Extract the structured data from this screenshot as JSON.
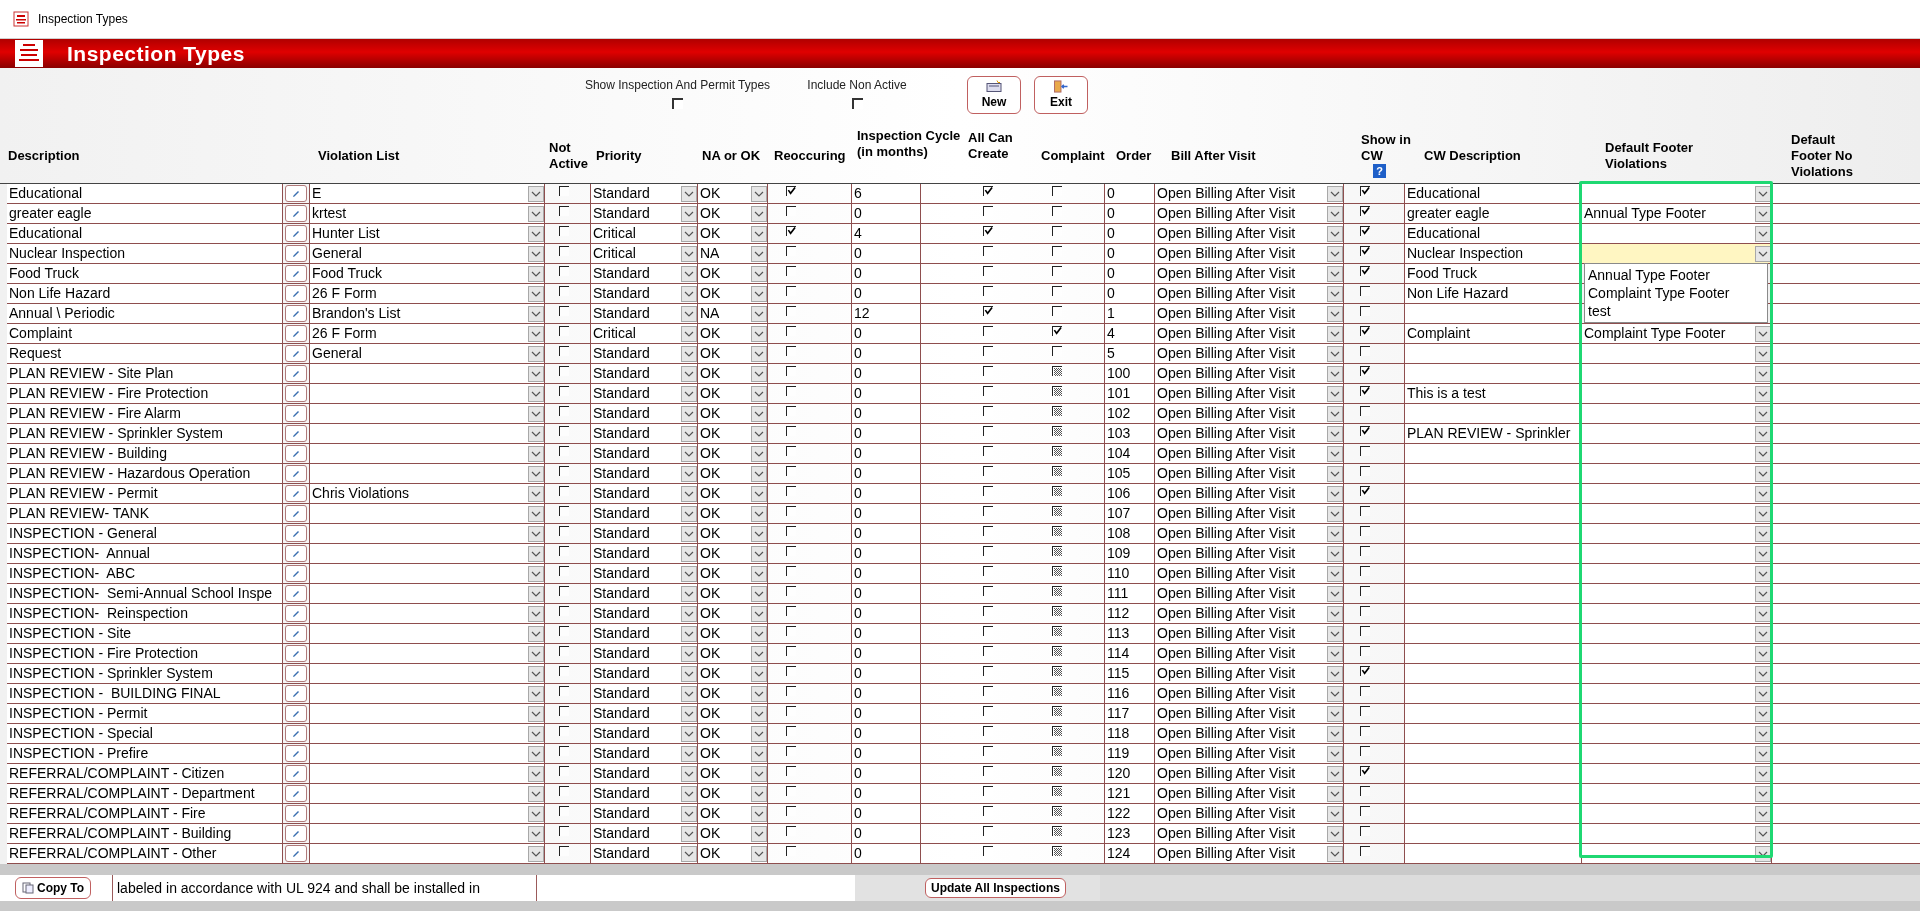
{
  "window": {
    "title": "Inspection Types"
  },
  "banner": {
    "title": "Inspection Types"
  },
  "filters": [
    {
      "label": "Show Inspection And Permit Types",
      "checked": false
    },
    {
      "label": "Include Non Active",
      "checked": false
    }
  ],
  "buttons": [
    {
      "label": "New",
      "kind": "new"
    },
    {
      "label": "Exit",
      "kind": "exit"
    }
  ],
  "table": {
    "footer_column_selected": true,
    "columns": [
      {
        "label": "Description"
      },
      {
        "label": "Violation List"
      },
      {
        "label": "Not Active"
      },
      {
        "label": "Priority"
      },
      {
        "label": "NA or OK"
      },
      {
        "label": "Reoccuring"
      },
      {
        "label": "Inspection Cycle (in months)"
      },
      {
        "label": "All Can Create"
      },
      {
        "label": "Complaint"
      },
      {
        "label": "Order"
      },
      {
        "label": "Bill After Visit"
      },
      {
        "label": "Show in CW",
        "help": "?"
      },
      {
        "label": "CW Description"
      },
      {
        "label": "Default Footer Violations"
      },
      {
        "label": "Default Footer No Violations"
      }
    ],
    "rows": [
      {
        "description": "Educational",
        "violation_list": "E",
        "not_active": false,
        "priority": "Standard",
        "na_ok": "OK",
        "reoccuring": true,
        "cycle": "6",
        "all_can_create": true,
        "complaint": false,
        "complaint_mixed": false,
        "order": "0",
        "bill": "Open Billing After Visit",
        "show_in_cw": true,
        "cw_description": "Educational",
        "footer_open": false
      },
      {
        "description": "greater eagle",
        "violation_list": "krtest",
        "not_active": false,
        "priority": "Standard",
        "na_ok": "OK",
        "reoccuring": false,
        "cycle": "0",
        "all_can_create": false,
        "complaint": false,
        "complaint_mixed": false,
        "order": "0",
        "bill": "Open Billing After Visit",
        "show_in_cw": true,
        "cw_description": "greater eagle",
        "footer": "Annual Type Footer",
        "footer_open": false
      },
      {
        "description": "Educational",
        "violation_list": "Hunter List",
        "not_active": false,
        "priority": "Critical",
        "na_ok": "OK",
        "reoccuring": true,
        "cycle": "4",
        "all_can_create": true,
        "complaint": false,
        "complaint_mixed": false,
        "order": "0",
        "bill": "Open Billing After Visit",
        "show_in_cw": true,
        "cw_description": "Educational",
        "footer_open": false
      },
      {
        "description": "Nuclear Inspection",
        "violation_list": "General",
        "not_active": false,
        "priority": "Critical",
        "na_ok": "NA",
        "reoccuring": false,
        "cycle": "0",
        "all_can_create": false,
        "complaint": false,
        "complaint_mixed": false,
        "order": "0",
        "bill": "Open Billing After Visit",
        "show_in_cw": true,
        "cw_description": "Nuclear Inspection",
        "footer_open": true,
        "footer_options": [
          "Annual Type Footer",
          "Complaint Type Footer",
          "test"
        ]
      },
      {
        "description": "Food Truck",
        "violation_list": "Food Truck",
        "not_active": false,
        "priority": "Standard",
        "na_ok": "OK",
        "reoccuring": false,
        "cycle": "0",
        "all_can_create": false,
        "complaint": false,
        "complaint_mixed": false,
        "order": "0",
        "bill": "Open Billing After Visit",
        "show_in_cw": true,
        "cw_description": "Food Truck",
        "footer_open": false
      },
      {
        "description": "Non Life Hazard",
        "violation_list": "26 F Form",
        "not_active": false,
        "priority": "Standard",
        "na_ok": "OK",
        "reoccuring": false,
        "cycle": "0",
        "all_can_create": false,
        "complaint": false,
        "complaint_mixed": false,
        "order": "0",
        "bill": "Open Billing After Visit",
        "show_in_cw": false,
        "cw_description": "Non Life Hazard",
        "footer_open": false
      },
      {
        "description": "Annual \\ Periodic",
        "violation_list": "Brandon's List",
        "not_active": false,
        "priority": "Standard",
        "na_ok": "NA",
        "reoccuring": false,
        "cycle": "12",
        "all_can_create": true,
        "complaint": false,
        "complaint_mixed": false,
        "order": "1",
        "bill": "Open Billing After Visit",
        "show_in_cw": false,
        "footer_open": false
      },
      {
        "description": "Complaint",
        "violation_list": "26 F Form",
        "not_active": false,
        "priority": "Critical",
        "na_ok": "OK",
        "reoccuring": false,
        "cycle": "0",
        "all_can_create": false,
        "complaint": true,
        "complaint_mixed": false,
        "order": "4",
        "bill": "Open Billing After Visit",
        "show_in_cw": true,
        "cw_description": "Complaint",
        "footer": "Complaint Type Footer",
        "footer_open": false
      },
      {
        "description": "Request",
        "violation_list": "General",
        "not_active": false,
        "priority": "Standard",
        "na_ok": "OK",
        "reoccuring": false,
        "cycle": "0",
        "all_can_create": false,
        "complaint": false,
        "complaint_mixed": false,
        "order": "5",
        "bill": "Open Billing After Visit",
        "show_in_cw": false,
        "footer_open": false
      },
      {
        "description": "PLAN REVIEW - Site Plan",
        "not_active": false,
        "priority": "Standard",
        "na_ok": "OK",
        "reoccuring": false,
        "cycle": "0",
        "all_can_create": false,
        "complaint_mixed": true,
        "order": "100",
        "bill": "Open Billing After Visit",
        "show_in_cw": true,
        "footer_open": false
      },
      {
        "description": "PLAN REVIEW - Fire Protection",
        "not_active": false,
        "priority": "Standard",
        "na_ok": "OK",
        "reoccuring": false,
        "cycle": "0",
        "all_can_create": false,
        "complaint_mixed": true,
        "order": "101",
        "bill": "Open Billing After Visit",
        "show_in_cw": true,
        "cw_description": "This is a test",
        "footer_open": false
      },
      {
        "description": "PLAN REVIEW - Fire Alarm",
        "not_active": false,
        "priority": "Standard",
        "na_ok": "OK",
        "reoccuring": false,
        "cycle": "0",
        "all_can_create": false,
        "complaint_mixed": true,
        "order": "102",
        "bill": "Open Billing After Visit",
        "show_in_cw": false,
        "footer_open": false
      },
      {
        "description": "PLAN REVIEW - Sprinkler System",
        "not_active": false,
        "priority": "Standard",
        "na_ok": "OK",
        "reoccuring": false,
        "cycle": "0",
        "all_can_create": false,
        "complaint_mixed": true,
        "order": "103",
        "bill": "Open Billing After Visit",
        "show_in_cw": true,
        "cw_description": "PLAN REVIEW - Sprinkler",
        "footer_open": false
      },
      {
        "description": "PLAN REVIEW - Building",
        "not_active": false,
        "priority": "Standard",
        "na_ok": "OK",
        "reoccuring": false,
        "cycle": "0",
        "all_can_create": false,
        "complaint_mixed": true,
        "order": "104",
        "bill": "Open Billing After Visit",
        "show_in_cw": false,
        "footer_open": false
      },
      {
        "description": "PLAN REVIEW - Hazardous Operation",
        "not_active": false,
        "priority": "Standard",
        "na_ok": "OK",
        "reoccuring": false,
        "cycle": "0",
        "all_can_create": false,
        "complaint_mixed": true,
        "order": "105",
        "bill": "Open Billing After Visit",
        "show_in_cw": false,
        "footer_open": false
      },
      {
        "description": "PLAN REVIEW - Permit",
        "violation_list": "Chris Violations",
        "not_active": false,
        "priority": "Standard",
        "na_ok": "OK",
        "reoccuring": false,
        "cycle": "0",
        "all_can_create": false,
        "complaint_mixed": true,
        "order": "106",
        "bill": "Open Billing After Visit",
        "show_in_cw": true,
        "footer_open": false
      },
      {
        "description": "PLAN REVIEW- TANK",
        "not_active": false,
        "priority": "Standard",
        "na_ok": "OK",
        "reoccuring": false,
        "cycle": "0",
        "all_can_create": false,
        "complaint_mixed": true,
        "order": "107",
        "bill": "Open Billing After Visit",
        "show_in_cw": false,
        "footer_open": false
      },
      {
        "description": "INSPECTION - General",
        "not_active": false,
        "priority": "Standard",
        "na_ok": "OK",
        "reoccuring": false,
        "cycle": "0",
        "all_can_create": false,
        "complaint_mixed": true,
        "order": "108",
        "bill": "Open Billing After Visit",
        "show_in_cw": false,
        "footer_open": false
      },
      {
        "description": "INSPECTION-  Annual",
        "not_active": false,
        "priority": "Standard",
        "na_ok": "OK",
        "reoccuring": false,
        "cycle": "0",
        "all_can_create": false,
        "complaint_mixed": true,
        "order": "109",
        "bill": "Open Billing After Visit",
        "show_in_cw": false,
        "footer_open": false
      },
      {
        "description": "INSPECTION-  ABC",
        "not_active": false,
        "priority": "Standard",
        "na_ok": "OK",
        "reoccuring": false,
        "cycle": "0",
        "all_can_create": false,
        "complaint_mixed": true,
        "order": "110",
        "bill": "Open Billing After Visit",
        "show_in_cw": false,
        "footer_open": false
      },
      {
        "description": "INSPECTION-  Semi-Annual School Inspe",
        "not_active": false,
        "priority": "Standard",
        "na_ok": "OK",
        "reoccuring": false,
        "cycle": "0",
        "all_can_create": false,
        "complaint_mixed": true,
        "order": "111",
        "bill": "Open Billing After Visit",
        "show_in_cw": false,
        "footer_open": false
      },
      {
        "description": "INSPECTION-  Reinspection",
        "not_active": false,
        "priority": "Standard",
        "na_ok": "OK",
        "reoccuring": false,
        "cycle": "0",
        "all_can_create": false,
        "complaint_mixed": true,
        "order": "112",
        "bill": "Open Billing After Visit",
        "show_in_cw": false,
        "footer_open": false
      },
      {
        "description": "INSPECTION - Site",
        "not_active": false,
        "priority": "Standard",
        "na_ok": "OK",
        "reoccuring": false,
        "cycle": "0",
        "all_can_create": false,
        "complaint_mixed": true,
        "order": "113",
        "bill": "Open Billing After Visit",
        "show_in_cw": false,
        "footer_open": false
      },
      {
        "description": "INSPECTION - Fire Protection",
        "not_active": false,
        "priority": "Standard",
        "na_ok": "OK",
        "reoccuring": false,
        "cycle": "0",
        "all_can_create": false,
        "complaint_mixed": true,
        "order": "114",
        "bill": "Open Billing After Visit",
        "show_in_cw": false,
        "footer_open": false
      },
      {
        "description": "INSPECTION - Sprinkler System",
        "not_active": false,
        "priority": "Standard",
        "na_ok": "OK",
        "reoccuring": false,
        "cycle": "0",
        "all_can_create": false,
        "complaint_mixed": true,
        "order": "115",
        "bill": "Open Billing After Visit",
        "show_in_cw": true,
        "footer_open": false
      },
      {
        "description": "INSPECTION -  BUILDING FINAL",
        "not_active": false,
        "priority": "Standard",
        "na_ok": "OK",
        "reoccuring": false,
        "cycle": "0",
        "all_can_create": false,
        "complaint_mixed": true,
        "order": "116",
        "bill": "Open Billing After Visit",
        "show_in_cw": false,
        "footer_open": false
      },
      {
        "description": "INSPECTION - Permit",
        "not_active": false,
        "priority": "Standard",
        "na_ok": "OK",
        "reoccuring": false,
        "cycle": "0",
        "all_can_create": false,
        "complaint_mixed": true,
        "order": "117",
        "bill": "Open Billing After Visit",
        "show_in_cw": false,
        "footer_open": false
      },
      {
        "description": "INSPECTION - Special",
        "not_active": false,
        "priority": "Standard",
        "na_ok": "OK",
        "reoccuring": false,
        "cycle": "0",
        "all_can_create": false,
        "complaint_mixed": true,
        "order": "118",
        "bill": "Open Billing After Visit",
        "show_in_cw": false,
        "footer_open": false
      },
      {
        "description": "INSPECTION - Prefire",
        "not_active": false,
        "priority": "Standard",
        "na_ok": "OK",
        "reoccuring": false,
        "cycle": "0",
        "all_can_create": false,
        "complaint_mixed": true,
        "order": "119",
        "bill": "Open Billing After Visit",
        "show_in_cw": false,
        "footer_open": false
      },
      {
        "description": "REFERRAL/COMPLAINT - Citizen",
        "not_active": false,
        "priority": "Standard",
        "na_ok": "OK",
        "reoccuring": false,
        "cycle": "0",
        "all_can_create": false,
        "complaint_mixed": true,
        "order": "120",
        "bill": "Open Billing After Visit",
        "show_in_cw": true,
        "footer_open": false
      },
      {
        "description": "REFERRAL/COMPLAINT - Department",
        "not_active": false,
        "priority": "Standard",
        "na_ok": "OK",
        "reoccuring": false,
        "cycle": "0",
        "all_can_create": false,
        "complaint_mixed": true,
        "order": "121",
        "bill": "Open Billing After Visit",
        "show_in_cw": false,
        "footer_open": false
      },
      {
        "description": "REFERRAL/COMPLAINT - Fire",
        "not_active": false,
        "priority": "Standard",
        "na_ok": "OK",
        "reoccuring": false,
        "cycle": "0",
        "all_can_create": false,
        "complaint_mixed": true,
        "order": "122",
        "bill": "Open Billing After Visit",
        "show_in_cw": false,
        "footer_open": false
      },
      {
        "description": "REFERRAL/COMPLAINT - Building",
        "not_active": false,
        "priority": "Standard",
        "na_ok": "OK",
        "reoccuring": false,
        "cycle": "0",
        "all_can_create": false,
        "complaint_mixed": true,
        "order": "123",
        "bill": "Open Billing After Visit",
        "show_in_cw": false,
        "footer_open": false
      },
      {
        "description": "REFERRAL/COMPLAINT - Other",
        "not_active": false,
        "priority": "Standard",
        "na_ok": "OK",
        "reoccuring": false,
        "cycle": "0",
        "all_can_create": false,
        "complaint_mixed": true,
        "order": "124",
        "bill": "Open Billing After Visit",
        "show_in_cw": false,
        "footer_open": false
      }
    ]
  },
  "bottom": {
    "copy_button": "Copy To",
    "note": "labeled in accordance with UL 924 and shall be installed in",
    "update_button": "Update All Inspections"
  }
}
